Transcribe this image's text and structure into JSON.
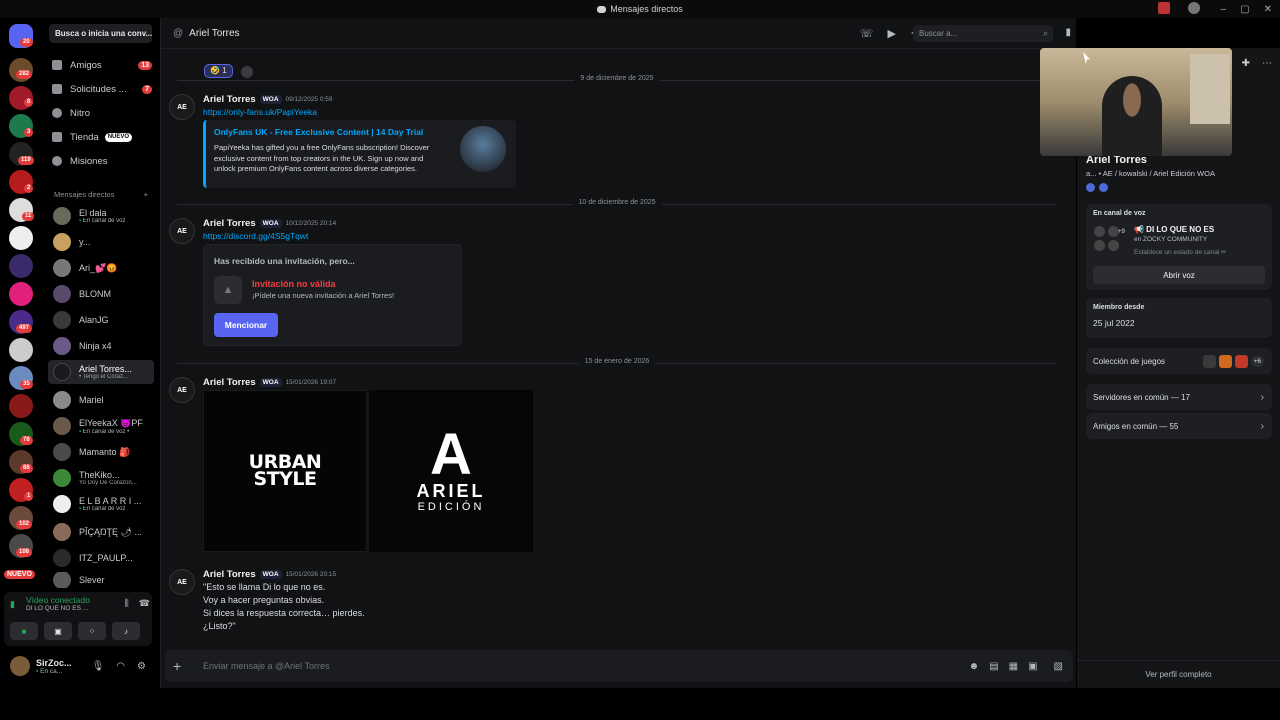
{
  "window": {
    "title": "Mensajes directos",
    "controls": [
      "–",
      "▢",
      "✕"
    ]
  },
  "rail": {
    "badges": [
      {
        "label": "20"
      },
      {
        "label": "282"
      },
      {
        "label": "8"
      },
      {
        "label": "3"
      },
      {
        "label": "119"
      },
      {
        "label": "2"
      },
      {
        "label": "11"
      },
      {
        "label": "497"
      },
      {
        "label": "35"
      },
      {
        "label": "78"
      },
      {
        "label": "86"
      },
      {
        "label": "1"
      },
      {
        "label": "102"
      },
      {
        "label": "108"
      }
    ],
    "nuevo": "NUEVO"
  },
  "sidebar": {
    "search_label": "Busca o inicia una conv...",
    "nav": [
      {
        "label": "Amigos",
        "count": "13"
      },
      {
        "label": "Solicitudes ...",
        "count": "7"
      },
      {
        "label": "Nitro",
        "count": ""
      },
      {
        "label": "Tienda",
        "tag": "NUEVO"
      },
      {
        "label": "Misiones",
        "count": ""
      }
    ],
    "dm_header": "Mensajes directos",
    "dm_add": "+",
    "dms": [
      {
        "name": "El dala",
        "sub": "En canal de voz"
      },
      {
        "name": "y...",
        "sub": ""
      },
      {
        "name": "Ari_💕😡",
        "sub": ""
      },
      {
        "name": "BLONM",
        "sub": ""
      },
      {
        "name": "AlanJG",
        "sub": ""
      },
      {
        "name": "Ninja x4",
        "sub": ""
      },
      {
        "name": "Ariel Torres...",
        "sub": "• Tengo el Coraz..."
      },
      {
        "name": "Mariel",
        "sub": ""
      },
      {
        "name": "ElYeekaX 😈PF",
        "sub": "En canal de voz •"
      },
      {
        "name": "Mamanto 🎒",
        "sub": ""
      },
      {
        "name": "TheKiko...",
        "sub": "Yo Doy De Corazon..."
      },
      {
        "name": "E L B A R R I ...",
        "sub": "En canal de voz"
      },
      {
        "name": "PĬÇĄŊŢĘ 🌶 ...",
        "sub": ""
      },
      {
        "name": "ITZ_PAULP...",
        "sub": ""
      },
      {
        "name": "Slever",
        "sub": ""
      }
    ]
  },
  "voice_panel": {
    "status": "Vídeo conectado",
    "channel": "DI LO QUE NO ES ..."
  },
  "user_panel": {
    "name": "SirZoc...",
    "status": "En ca..."
  },
  "chat": {
    "recipient": "Ariel Torres",
    "search_placeholder": "Buscar a...",
    "reaction_count": "1",
    "composer_placeholder": "Enviar mensaje a @Ariel Torres",
    "dates": [
      "9 de diciembre de 2025",
      "10 de diciembre de 2025",
      "15 de enero de 2026"
    ],
    "messages": [
      {
        "author": "Ariel Torres",
        "tag": "WOA",
        "timestamp": "09/12/2025 0:59",
        "link": "https://only-fans.uk/PapiYeeka",
        "embed_title": "OnlyFans UK - Free Exclusive Content | 14 Day Trial",
        "embed_desc": "PapiYeeka has gifted you a free OnlyFans subscription! Discover exclusive content from top creators in the UK. Sign up now and unlock premium OnlyFans content across diverse categories."
      },
      {
        "author": "Ariel Torres",
        "tag": "WOA",
        "timestamp": "10/12/2025 20:14",
        "link": "https://discord.gg/4S5gTqwt",
        "invite_header": "Has recibido una invitación, pero...",
        "invite_title": "Invitación no válida",
        "invite_sub": "¡Pídele una nueva invitación a Ariel Torres!",
        "invite_button": "Mencionar"
      },
      {
        "author": "Ariel Torres",
        "tag": "WOA",
        "timestamp": "15/01/2026 19:07",
        "img1_line1": "URBAN",
        "img1_line2": "STYLE",
        "img2_logo": "A",
        "img2_name": "ARIEL",
        "img2_sub": "EDICIÓN"
      },
      {
        "author": "Ariel Torres",
        "tag": "WOA",
        "timestamp": "15/01/2026 20:15",
        "lines": [
          "\"Esto se llama Di lo que no es.",
          "Voy a hacer preguntas obvias.",
          "Si dices la respuesta correcta… pierdes.",
          "¿Listo?\""
        ]
      }
    ],
    "avatar_initials": "AE"
  },
  "profile": {
    "name": "Ariel Torres",
    "tagline": "a... • AE / kowalski / Ariel Edición",
    "tag": "WOA",
    "voice": {
      "label": "En canal de voz",
      "channel": "📢 DI LO QUE NO ES",
      "server": "en ZOCKY COMMUNITY",
      "status": "Establece un estado de canal ✏",
      "button": "Abrir voz",
      "extra": "+9"
    },
    "member_since_label": "Miembro desde",
    "member_since": "25 jul 2022",
    "games_label": "Colección de juegos",
    "games_more": "+6",
    "servers_common": "Servidores en común — 17",
    "friends_common": "Amigos en común — 55",
    "full_profile": "Ver perfil completo"
  }
}
